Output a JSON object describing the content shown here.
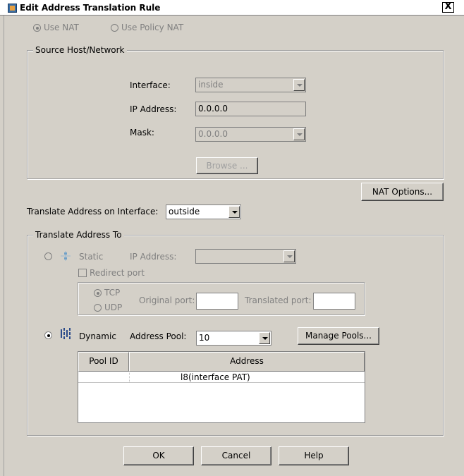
{
  "window": {
    "title": "Edit Address Translation Rule",
    "close_glyph": "X"
  },
  "nat_type": {
    "use_nat_label": "Use NAT",
    "use_policy_nat_label": "Use Policy NAT",
    "selected": "Use NAT"
  },
  "source": {
    "group_title": "Source Host/Network",
    "interface_label": "Interface:",
    "interface_value": "inside",
    "ip_label": "IP Address:",
    "ip_value": "0.0.0.0",
    "mask_label": "Mask:",
    "mask_value": "0.0.0.0",
    "browse_label": "Browse ..."
  },
  "nat_options_label": "NAT Options...",
  "translate_iface": {
    "label": "Translate Address on Interface:",
    "value": "outside"
  },
  "translate_to": {
    "group_title": "Translate Address To",
    "static_label": "Static",
    "static_ip_label": "IP Address:",
    "static_ip_value": "",
    "redirect_label": "Redirect port",
    "tcp_label": "TCP",
    "udp_label": "UDP",
    "original_port_label": "Original port:",
    "original_port_value": "",
    "translated_port_label": "Translated port:",
    "translated_port_value": "",
    "dynamic_label": "Dynamic",
    "pool_label": "Address Pool:",
    "pool_value": "10",
    "manage_pools_label": "Manage Pools...",
    "selected_mode": "Dynamic",
    "selected_protocol": "TCP"
  },
  "pool_table": {
    "columns": [
      "Pool ID",
      "Address"
    ],
    "rows": [
      {
        "pool_id": "",
        "address": "l8(interface PAT)"
      }
    ]
  },
  "footer": {
    "ok_label": "OK",
    "cancel_label": "Cancel",
    "help_label": "Help"
  },
  "colors": {
    "dialog_bg": "#d4d0c8",
    "disabled_text": "#808080",
    "static_icon": "#3a7ab0",
    "dynamic_icon": "#2a4a8a"
  },
  "icons": {
    "static": "static-nat-icon",
    "dynamic": "dynamic-nat-icon",
    "window": "window-app-icon"
  }
}
